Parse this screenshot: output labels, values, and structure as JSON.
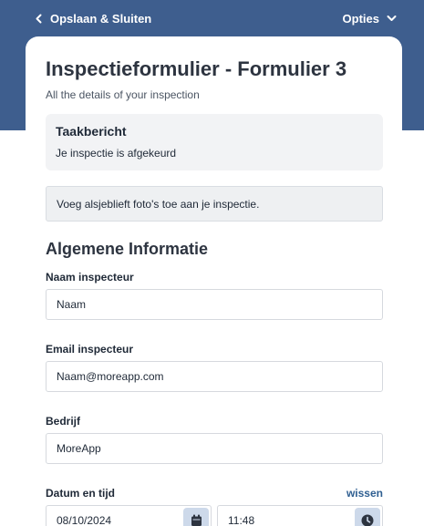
{
  "topbar": {
    "back_label": "Opslaan & Sluiten",
    "options_label": "Opties"
  },
  "header": {
    "title": "Inspectieformulier - Formulier 3",
    "subtitle": "All the details of your inspection"
  },
  "task": {
    "title": "Taakbericht",
    "message": "Je inspectie is afgekeurd"
  },
  "notice": "Voeg alsjeblieft foto's toe aan je inspectie.",
  "section": {
    "title": "Algemene Informatie"
  },
  "fields": {
    "inspector_name": {
      "label": "Naam inspecteur",
      "value": "Naam"
    },
    "inspector_email": {
      "label": "Email inspecteur",
      "value": "Naam@moreapp.com"
    },
    "company": {
      "label": "Bedrijf",
      "value": "MoreApp"
    }
  },
  "datetime": {
    "label": "Datum en tijd",
    "clear_label": "wissen",
    "date": "08/10/2024",
    "time": "11:48"
  },
  "icons": {
    "back": "chevron-left-icon",
    "options": "chevron-down-icon",
    "date": "calendar-icon",
    "time": "clock-icon"
  },
  "colors": {
    "header_band": "#3e5e8e",
    "accent": "#2f5f91",
    "picker_button": "#cdd9ea"
  }
}
